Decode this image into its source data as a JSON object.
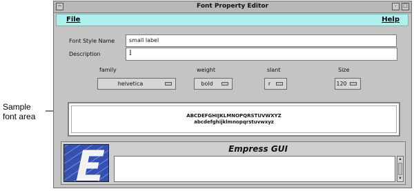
{
  "annotation": {
    "text": "Sample\nfont area"
  },
  "window": {
    "title": "Font Property Editor",
    "menu": {
      "file": "File",
      "help": "Help"
    }
  },
  "form": {
    "font_style_name": {
      "label": "Font Style Name",
      "value": "small label"
    },
    "description": {
      "label": "Description",
      "value": "",
      "cursor": "I"
    }
  },
  "options": {
    "family": {
      "label": "family",
      "value": "helvetica"
    },
    "weight": {
      "label": "weight",
      "value": "bold"
    },
    "slant": {
      "label": "slant",
      "value": "r"
    },
    "size": {
      "label": "Size",
      "value": "120"
    }
  },
  "sample": {
    "upper": "ABCDEFGHIJKLMNOPQRSTUVWXYZ",
    "lower": "abcdefghijklmnopqrstuvwxyz"
  },
  "footer": {
    "brand": "Empress GUI",
    "logo_letter": "E",
    "logo_color": "#3550b0",
    "menubar_color": "#aef0ee"
  },
  "icons": {
    "window_menu": "minus-icon",
    "minimize": "minus-icon",
    "maximize": "square-icon",
    "scroll_up": "triangle-up-icon",
    "scroll_down": "triangle-down-icon"
  }
}
